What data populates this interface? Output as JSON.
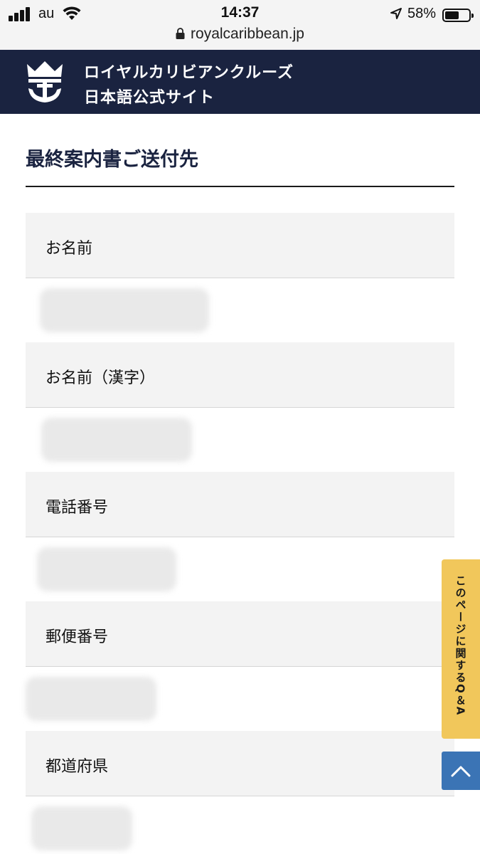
{
  "status_bar": {
    "carrier": "au",
    "time": "14:37",
    "battery_percent": "58%",
    "battery_level": 0.58,
    "url": "royalcaribbean.jp",
    "icons": [
      "signal-icon",
      "wifi-icon",
      "location-arrow-icon",
      "battery-icon",
      "lock-icon"
    ]
  },
  "header": {
    "brand_line1": "ロイヤルカリビアンクルーズ",
    "brand_line2": "日本語公式サイト",
    "logo_icon": "crown-anchor-logo",
    "background_color": "#1a2340"
  },
  "section": {
    "title": "最終案内書ご送付先"
  },
  "fields": [
    {
      "label": "お名前"
    },
    {
      "label": "お名前（漢字）"
    },
    {
      "label": "電話番号"
    },
    {
      "label": "郵便番号"
    },
    {
      "label": "都道府県"
    }
  ],
  "floating": {
    "qa_label": "このページに関するQ＆A",
    "qa_color": "#f1c75b",
    "to_top_icon": "chevron-up-icon",
    "to_top_color": "#3b74b5"
  }
}
